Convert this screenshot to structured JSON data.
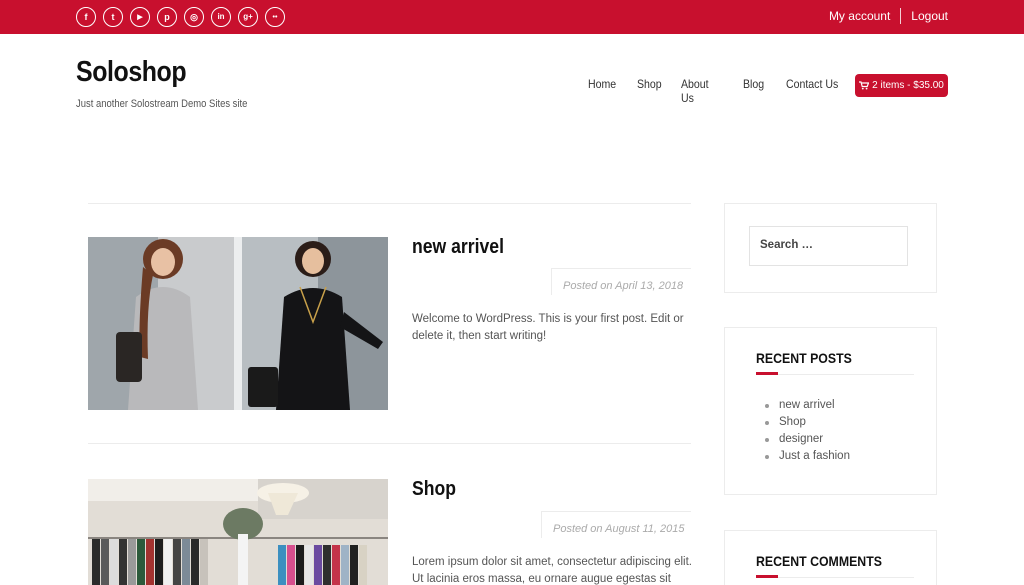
{
  "topbar": {
    "social": [
      {
        "name": "facebook-icon",
        "glyph": "f"
      },
      {
        "name": "twitter-icon",
        "glyph": "t"
      },
      {
        "name": "youtube-icon",
        "glyph": "▶"
      },
      {
        "name": "pinterest-icon",
        "glyph": "p"
      },
      {
        "name": "instagram-icon",
        "glyph": "◎"
      },
      {
        "name": "linkedin-icon",
        "glyph": "in"
      },
      {
        "name": "google-plus-icon",
        "glyph": "g+"
      },
      {
        "name": "flickr-icon",
        "glyph": "••"
      }
    ],
    "my_account": "My account",
    "logout": "Logout"
  },
  "header": {
    "site_title": "Soloshop",
    "tagline": "Just another Solostream Demo Sites site",
    "nav": [
      "Home",
      "Shop",
      "About Us",
      "Blog",
      "Contact Us"
    ],
    "cart_label": "2 items - $35.00"
  },
  "posts": [
    {
      "title": "new arrivel",
      "meta": "Posted on April 13, 2018",
      "excerpt": "Welcome to WordPress. This is your first post. Edit or delete it, then start writing!"
    },
    {
      "title": "Shop",
      "meta": "Posted on August 11, 2015",
      "excerpt": "Lorem ipsum dolor sit amet, consectetur adipiscing elit. Ut lacinia eros massa, eu ornare augue egestas sit"
    }
  ],
  "sidebar": {
    "search_placeholder": "Search …",
    "recent_posts_title": "RECENT POSTS",
    "recent_posts": [
      "new arrivel",
      "Shop",
      "designer",
      "Just a fashion"
    ],
    "recent_comments_title": "RECENT COMMENTS"
  },
  "colors": {
    "accent": "#c8102e"
  }
}
